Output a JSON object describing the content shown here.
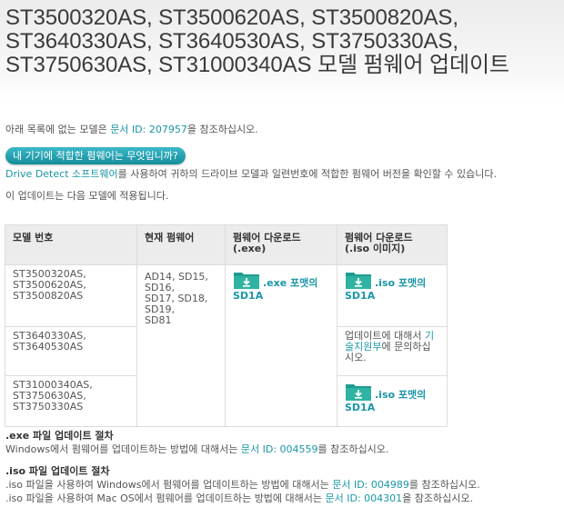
{
  "page": {
    "title": "ST3500320AS, ST3500620AS, ST3500820AS, ST3640330AS, ST3640530AS, ST3750330AS, ST3750630AS, ST31000340AS 모델 펌웨어 업데이트",
    "intro_before": "아래 목록에 없는 모델은 ",
    "intro_link": "문서 ID: 207957",
    "intro_after": "을 참조하십시오.",
    "help_button": "내 기기에 적합한 펌웨어는 무엇입니까?",
    "detect_link": "Drive Detect 소프트웨어",
    "detect_after": "를 사용하여 귀하의 드라이브 모델과 일련번호에 적합한 펌웨어 버전을 확인할 수 있습니다.",
    "applies_text": "이 업데이트는 다음 모델에 적용됩니다."
  },
  "table": {
    "headers": {
      "model": "모델 번호",
      "current": "현재 펌웨어",
      "exe_line1": "펌웨어 다운로드",
      "exe_line2": "(.exe)",
      "iso_line1": "펌웨어 다운로드",
      "iso_line2": "(.iso 이미지)"
    },
    "row1_models": [
      "ST3500320AS,",
      "ST3500620AS,",
      "ST3500820AS"
    ],
    "row2_models": [
      "ST3640330AS,",
      "ST3640530AS"
    ],
    "row3_models": [
      "ST31000340AS,",
      "ST3750630AS,",
      "ST3750330AS"
    ],
    "current_firmware": [
      "AD14, SD15,",
      "SD16,",
      "SD17, SD18,",
      "SD19,",
      "SD81"
    ],
    "exe_download": {
      "label": ".exe 포맷의",
      "version": "SD1A"
    },
    "iso_download_1": {
      "label": ".iso 포맷의",
      "version": "SD1A"
    },
    "iso_download_2": {
      "label": ".iso 포맷의",
      "version": "SD1A"
    },
    "support_note": {
      "before": "업데이트에 대해서 ",
      "link": "기술지원부",
      "after": "에 문의하십시오."
    }
  },
  "exe_section": {
    "heading": ".exe 파일 업데이트 절차",
    "line_before": "Windows에서 펌웨어를 업데이트하는 방법에 대해서는 ",
    "line_link": "문서 ID: 004559",
    "line_after": "를 참조하십시오."
  },
  "iso_section": {
    "heading": ".iso 파일 업데이트 절차",
    "line1_before": ".iso 파일을 사용하여 Windows에서 펌웨어를 업데이트하는 방법에 대해서는 ",
    "line1_link": "문서 ID: 004989",
    "line1_after": "를 참조하십시오.",
    "line2_before": ".iso 파일을 사용하여 Mac OS에서 펌웨어를 업데이트하는 방법에 대해서는 ",
    "line2_link": "문서 ID: 004301",
    "line2_after": "을 참조하십시오."
  },
  "colors": {
    "link": "#1a96a7",
    "button": "#1e9eae",
    "folder_icon": "#1f9c8e",
    "header_bg": "#ececec"
  },
  "icons": [
    "download-folder-icon"
  ]
}
